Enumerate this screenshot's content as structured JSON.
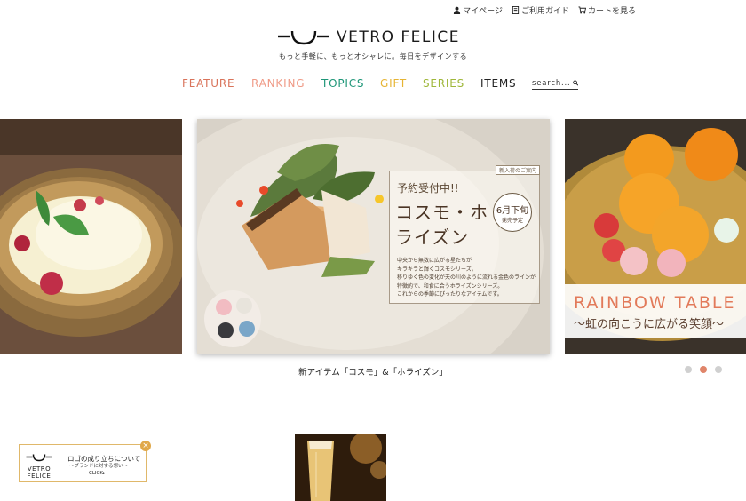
{
  "header": {
    "links": [
      {
        "icon": "user-icon",
        "label": "マイページ"
      },
      {
        "icon": "guide-icon",
        "label": "ご利用ガイド"
      },
      {
        "icon": "cart-icon",
        "label": "カートを見る"
      }
    ],
    "brand": "VETRO FELICE",
    "tagline": "もっと手軽に、もっとオシャレに。毎日をデザインする"
  },
  "nav": {
    "items": [
      "FEATURE",
      "RANKING",
      "TOPICS",
      "GIFT",
      "SERIES",
      "ITEMS"
    ],
    "search_placeholder": "search..."
  },
  "carousel": {
    "main": {
      "tag": "新入荷のご案内",
      "subtitle": "予約受付中!!",
      "title": "コスモ・ホライズン",
      "date_main": "6月下旬",
      "date_sub": "発売予定",
      "body": "中央から無数に広がる星たちが\nキラキラと輝くコスモシリーズ。\n移りゆく色の変化が天の川のように流れる金色のラインが特徴的で、和食に合うホライズンシリーズ。\nこれからの季節にぴったりなアイテムです。"
    },
    "right": {
      "title": "RAINBOW TABLE",
      "subtitle": "〜虹の向こうに広がる笑顔〜"
    },
    "caption": "新アイテム「コスモ」&「ホライズン」",
    "dots": 3,
    "active_dot": 2
  },
  "banner": {
    "logo_line1": "VETRO",
    "logo_line2": "FELICE",
    "title": "ロゴの成り立ちについて",
    "subtitle": "〜ブランドに対する想い〜",
    "cta": "CLICK▸",
    "close": "×"
  },
  "colors": {
    "feature": "#d9735a",
    "ranking": "#ef9a86",
    "topics": "#1e9678",
    "gift": "#e6b433",
    "series": "#9fb73a",
    "items": "#222222",
    "active_dot": "#e0856a"
  }
}
